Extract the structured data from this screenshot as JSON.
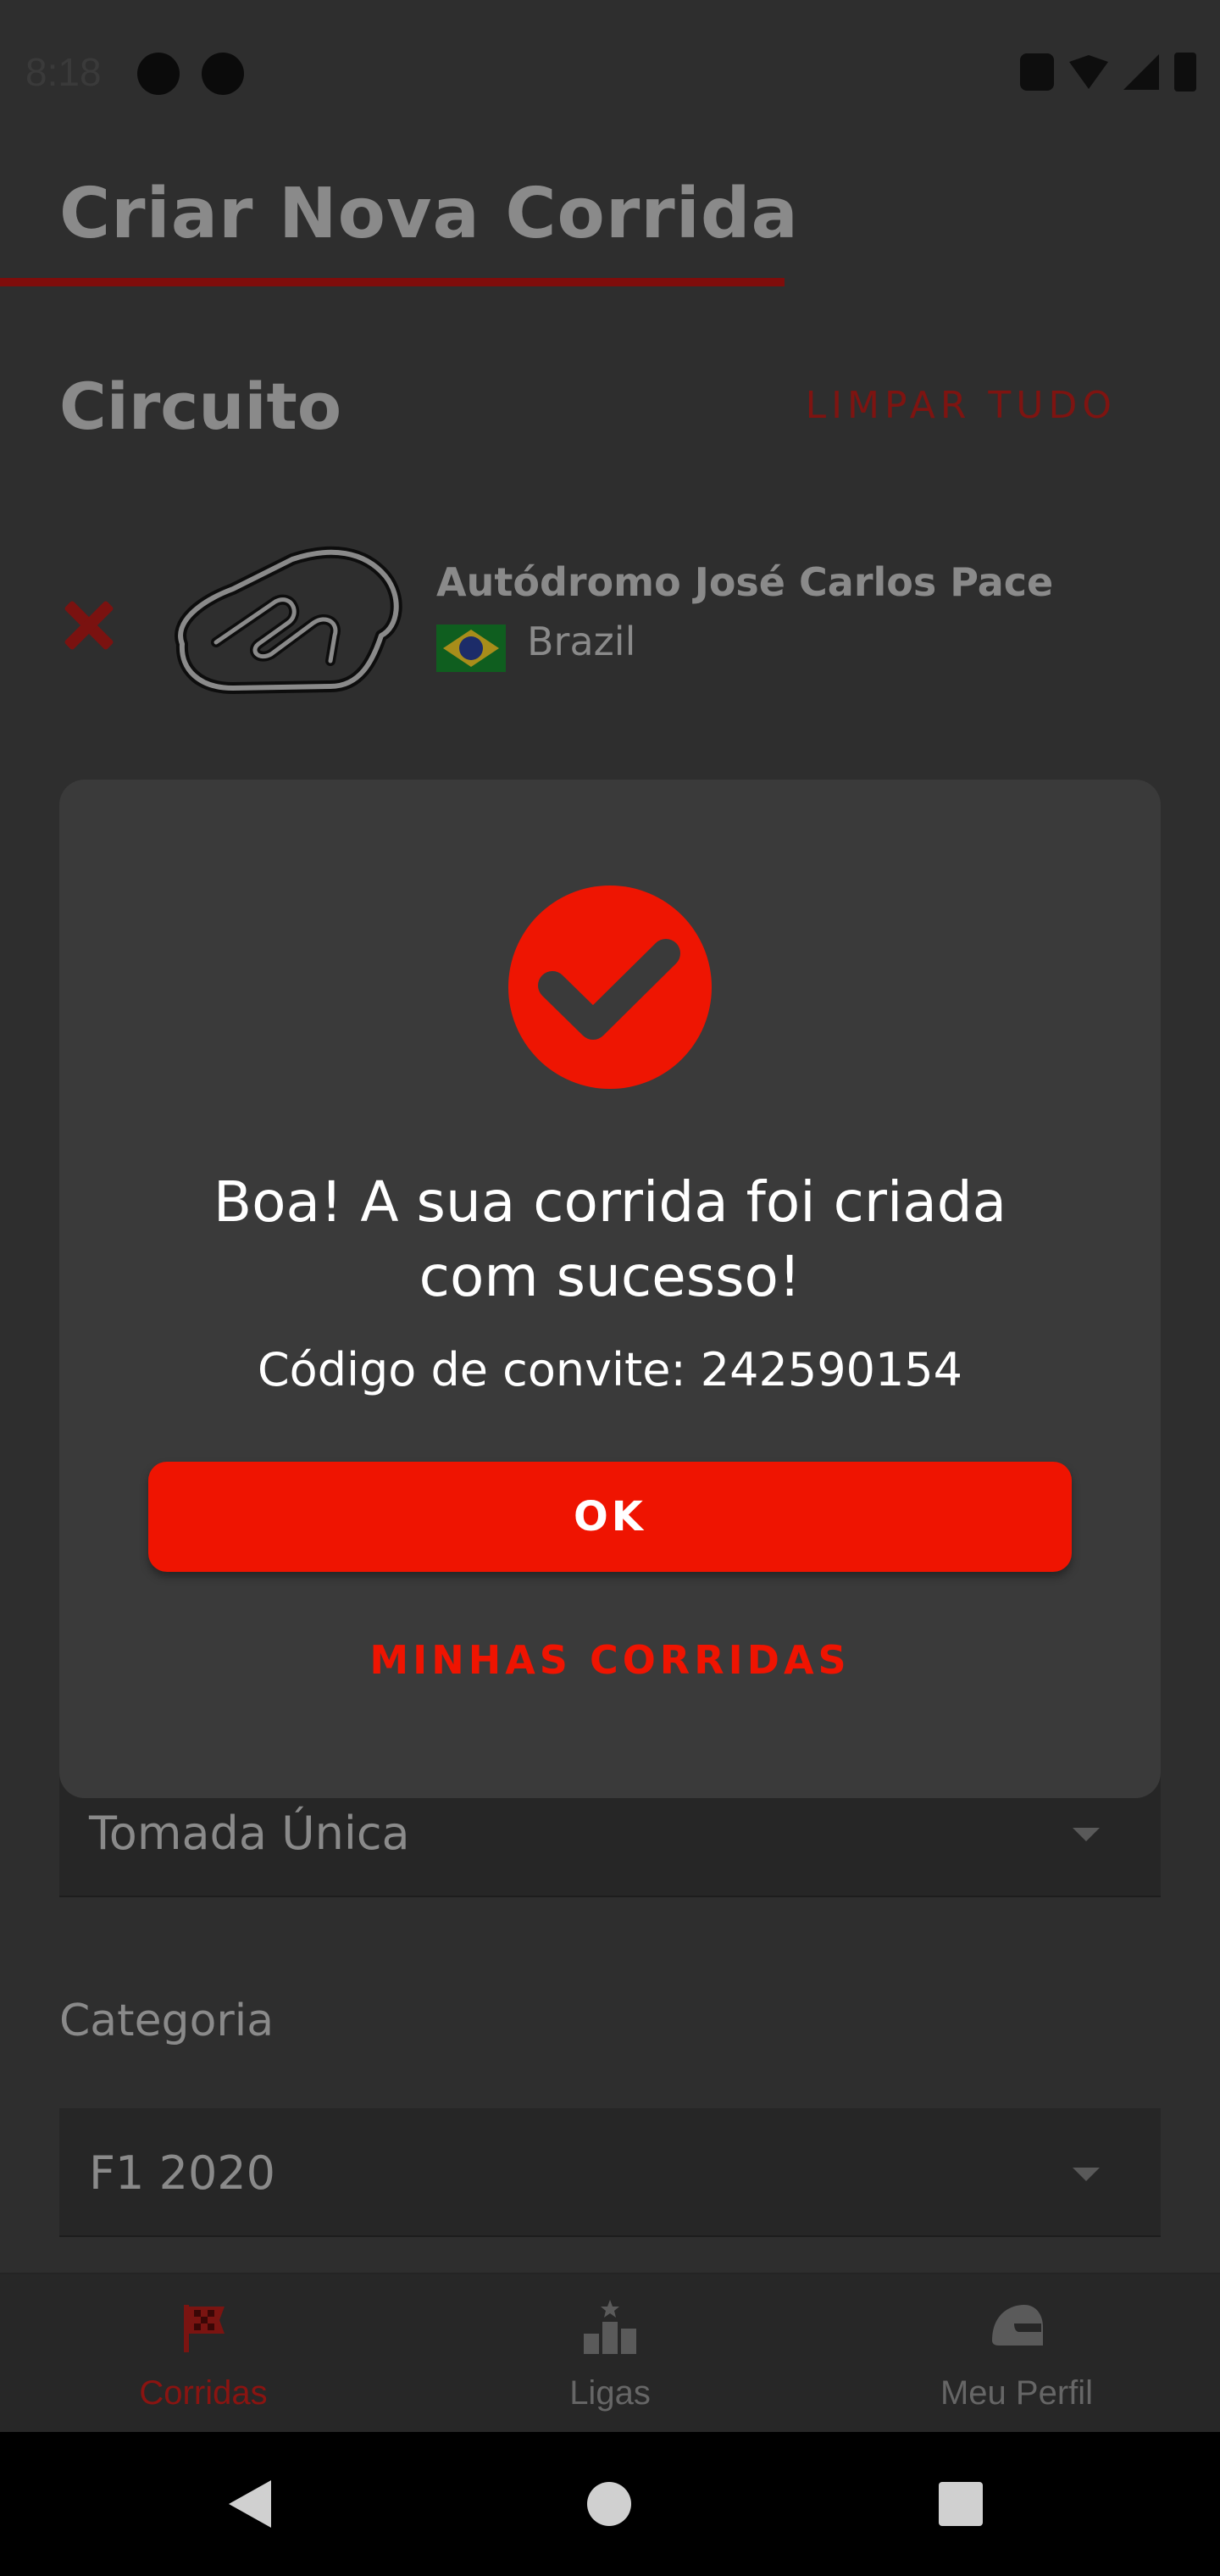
{
  "status_bar": {
    "time": "8:18"
  },
  "header": {
    "title": "Criar Nova Corrida"
  },
  "circuit_section": {
    "title": "Circuito",
    "clear_label": "LIMPAR TUDO",
    "circuit_name": "Autódromo José Carlos Pace",
    "country": "Brazil"
  },
  "form": {
    "session_value": "Tomada Única",
    "category_label": "Categoria",
    "category_value": "F1 2020"
  },
  "dialog": {
    "title_line1": "Boa! A sua corrida foi criada",
    "title_line2": "com sucesso!",
    "invite_text": "Código de convite: 242590154",
    "ok_label": "OK",
    "secondary_label": "MINHAS CORRIDAS"
  },
  "bottom_nav": {
    "items": [
      {
        "label": "Corridas",
        "icon": "checkered-flag-icon",
        "active": true
      },
      {
        "label": "Ligas",
        "icon": "podium-icon",
        "active": false
      },
      {
        "label": "Meu Perfil",
        "icon": "helmet-icon",
        "active": false
      }
    ]
  },
  "colors": {
    "accent": "#EF1401",
    "dialog_bg": "#3A3A3A",
    "screen_bg": "#2E2E2E"
  }
}
